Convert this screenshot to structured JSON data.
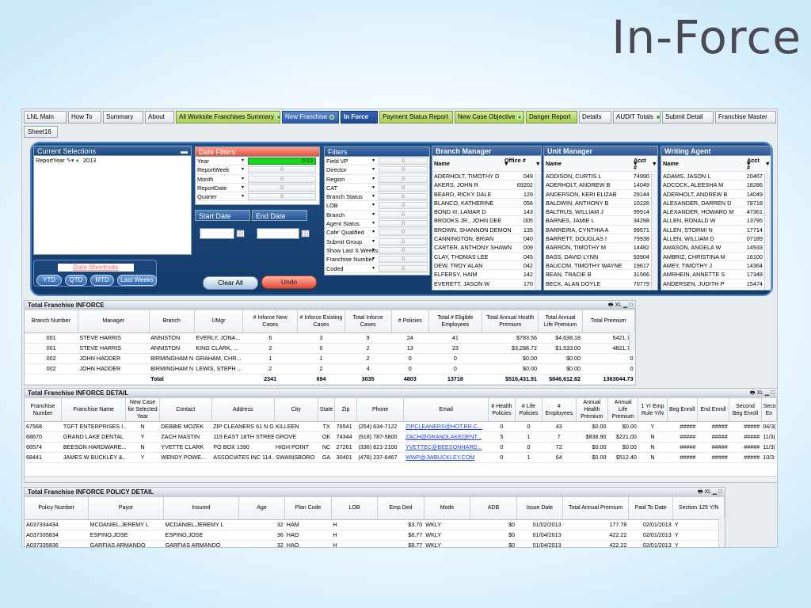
{
  "slide": {
    "title": "In-Force"
  },
  "tabs": [
    {
      "label": "LNL Main",
      "style": "plain"
    },
    {
      "label": "How To",
      "style": "plain"
    },
    {
      "label": "Summary",
      "style": "plain"
    },
    {
      "label": "About",
      "style": "plain"
    },
    {
      "label": "All Worksite Franchises Summary",
      "style": "green",
      "dot": true
    },
    {
      "label": "New Franchise",
      "style": "blue",
      "dot": true
    },
    {
      "label": "In Force",
      "style": "active"
    },
    {
      "label": "Payment Status Report",
      "style": "green",
      "dot": true
    },
    {
      "label": "New Case Objective",
      "style": "green",
      "dot": true
    },
    {
      "label": "Danger Report",
      "style": "green"
    },
    {
      "label": "Details",
      "style": "plain"
    },
    {
      "label": "AUDIT Totals",
      "style": "plain",
      "dot": true
    },
    {
      "label": "Submit Detail",
      "style": "plain"
    },
    {
      "label": "Franchise Master",
      "style": "plain"
    }
  ],
  "tab_row2": "Sheet16",
  "current_selections": {
    "title": "Current Selections",
    "field": "ReportYear",
    "value": "2013"
  },
  "date_filters": {
    "title": "Date Filters",
    "rows": [
      {
        "label": "Year",
        "value": "2013",
        "selected": true
      },
      {
        "label": "ReportWeek",
        "value": "0"
      },
      {
        "label": "Month",
        "value": "0"
      },
      {
        "label": "ReportDate",
        "value": "0"
      },
      {
        "label": "Quarter",
        "value": "0"
      }
    ],
    "start_label": "Start Date",
    "end_label": "End Date"
  },
  "shortcuts": {
    "title": "Date Shortcuts",
    "buttons": [
      "YTD",
      "QTD",
      "MTD",
      "Last Weeks"
    ]
  },
  "clear_label": "Clear All",
  "undo_label": "Undo",
  "filters": {
    "title": "Filters",
    "rows": [
      "Field VP",
      "Director",
      "Region",
      "CAT",
      "Branch Status",
      "LOB",
      "Branch",
      "Agent Status",
      "Cafe' Qualified",
      "Submit Group",
      "Show Last X Weeks",
      "Franchise Number",
      "Coded"
    ],
    "value": "0"
  },
  "branch_manager": {
    "title": "Branch Manager",
    "col1": "Name",
    "col2": "Office #",
    "rows": [
      [
        "ADERHOLT, TIMOTHY D",
        "049"
      ],
      [
        "AKERS, JOHN R",
        "69202"
      ],
      [
        "BEARD, RICKY DALE",
        "129"
      ],
      [
        "BLANCO, KATHERINE",
        "056"
      ],
      [
        "BOND III, LAMAR D",
        "143"
      ],
      [
        "BROOKS JR., JOHN DEE",
        "005"
      ],
      [
        "BROWN, SHANNON DEMON",
        "135"
      ],
      [
        "CANNINGTON, BRIAN",
        "040"
      ],
      [
        "CARTER, ANTHONY SHAWN",
        "009"
      ],
      [
        "CLAY, THOMAS LEE",
        "045"
      ],
      [
        "DEW, TROY ALAN",
        "042"
      ],
      [
        "ELFERSY, HAIM",
        "142"
      ],
      [
        "EVERETT, JASON W",
        "170"
      ]
    ]
  },
  "unit_manager": {
    "title": "Unit Manager",
    "col1": "Name",
    "col2": "Acct #",
    "rows": [
      [
        "ADDISON, CURTIS L",
        "74990"
      ],
      [
        "ADERHOLT, ANDREW B",
        "14049"
      ],
      [
        "ANDERSON, KERI ELIZAB",
        "29144"
      ],
      [
        "BALDWIN, ANTHONY B",
        "10226"
      ],
      [
        "BALTRUS, WILLIAM J",
        "99914"
      ],
      [
        "BARNES, JAMIE L",
        "34298"
      ],
      [
        "BARREIRA, CYNTHIA A",
        "99571"
      ],
      [
        "BARRETT, DOUGLAS I",
        "79938"
      ],
      [
        "BARRON, TIMOTHY M",
        "14482"
      ],
      [
        "BASS, DAVID LYNN",
        "93904"
      ],
      [
        "BAUCOM, TIMOTHY WAYNE",
        "19617"
      ],
      [
        "BEAN, TRACIE B",
        "31566"
      ],
      [
        "BECK, ALAN DOYLE",
        "70779"
      ]
    ]
  },
  "writing_agent": {
    "title": "Writing Agent",
    "col1": "Name",
    "col2": "Acct #",
    "rows": [
      [
        "ADAMS, JASON L",
        "20467"
      ],
      [
        "ADCOCK, ALEESHA M",
        "18286"
      ],
      [
        "ADERHOLT, ANDREW B",
        "14049"
      ],
      [
        "ALEXANDER, DARREN D",
        "78718"
      ],
      [
        "ALEXANDER, HOWARD M",
        "47361"
      ],
      [
        "ALLEN, RONALD W",
        "13795"
      ],
      [
        "ALLEN, STORMI N",
        "17714"
      ],
      [
        "ALLEN, WILLIAM D",
        "07189"
      ],
      [
        "AMASON, ANGELA W",
        "14933"
      ],
      [
        "AMBRIZ, CHRISTINA M",
        "16100"
      ],
      [
        "AMEY, TIMOTHY J",
        "14364"
      ],
      [
        "AMRHEIN, ANNETTE S",
        "17348"
      ],
      [
        "ANDERSEN, JUDITH P",
        "15474"
      ]
    ]
  },
  "inforce": {
    "title": "Total Franchise INFORCE",
    "controls": "🖶 XL ▁ ◻",
    "headers": [
      "Branch Number",
      "Manager",
      "Branch",
      "UMgr",
      "# Inforce New Cases",
      "# Inforce Existing Cases",
      "Total Inforce Cases",
      "# Policies",
      "Total # Eligible Employees",
      "Total Annual Health Premium",
      "Total Annual Life Premium",
      "Total Premium"
    ],
    "rows": [
      [
        "001",
        "STEVE HARRIS",
        "ANNISTON",
        "EVERLY, JONA...",
        "6",
        "3",
        "9",
        "24",
        "41",
        "$783.56",
        "$4,638.18",
        "5421.74"
      ],
      [
        "001",
        "STEVE HARRIS",
        "ANNISTON",
        "KING CLARK, ...",
        "2",
        "0",
        "2",
        "13",
        "23",
        "$3,288.72",
        "$1,533.00",
        "4821.72"
      ],
      [
        "002",
        "JOHN HADDER",
        "BIRMINGHAM N",
        "GRAHAM, CHR...",
        "1",
        "1",
        "2",
        "0",
        "0",
        "$0.00",
        "$0.00",
        "0"
      ],
      [
        "002",
        "JOHN HADDER",
        "BIRMINGHAM N",
        "LEWIS, STEPH ...",
        "2",
        "2",
        "4",
        "0",
        "0",
        "$0.00",
        "$0.00",
        "0"
      ]
    ],
    "total": [
      "",
      "",
      "Total",
      "",
      "2341",
      "694",
      "3035",
      "4803",
      "13718",
      "$516,431.91",
      "$846,612.82",
      "1363044.73"
    ]
  },
  "detail": {
    "title": "Total Franchise INFORCE DETAIL",
    "controls": "🖶 XL ▁ ◻",
    "headers": [
      "Franchise Number",
      "Franchise Name",
      "New Case for Selected Year",
      "Contact",
      "Address",
      "City",
      "State",
      "Zip",
      "Phone",
      "Email",
      "# Health Policies",
      "# Life Policies",
      "# Employees",
      "Annual Health Premium",
      "Annual Life Premium",
      "1 Yr Emp Rule Y/N",
      "Beg Enroll",
      "End Enroll",
      "Second Beg Enroll",
      "Second En"
    ],
    "rows": [
      [
        "67568",
        "TGFT ENTERPRISES I...",
        "N",
        "DEBBIE MOZEK",
        "ZIP CLEANERS 61 N GI...",
        "KILLEEN",
        "TX",
        "76541",
        "(254) 634-7122",
        "ZIPCLEANERS@HOT.RR.C...",
        "0",
        "0",
        "43",
        "$0.00",
        "$0.00",
        "Y",
        "#####",
        "#####",
        "#####",
        "04/3("
      ],
      [
        "68670",
        "GRAND LAKE DENTAL",
        "Y",
        "ZACH MASTIN",
        "119 EAST 18TH STREET",
        "GROVE",
        "OK",
        "74344",
        "(918) 787-5800",
        "ZACH@GRANDLAKEDENT...",
        "5",
        "1",
        "7",
        "$838.90",
        "$221.00",
        "N",
        "#####",
        "#####",
        "#####",
        "11/3("
      ],
      [
        "66574",
        "BEESON HARDWARE...",
        "N",
        "YVETTE CLARK",
        "PO BOX 1390",
        "HIGH POINT",
        "NC",
        "27261",
        "(336) 821-2100",
        "YVETTEC@BEESONHARD...",
        "0",
        "0",
        "72",
        "$0.00",
        "$0.00",
        "N",
        "#####",
        "#####",
        "#####",
        "11/3("
      ],
      [
        "68441",
        "JAMES W BUCKLEY &...",
        "Y",
        "WENDY POWE...",
        "ASSOCIATES INC 114...",
        "SWAINSBORO",
        "GA",
        "30401",
        "(478) 237-6467",
        "WWP@JWBUCKLEY.COM",
        "0",
        "1",
        "64",
        "$0.00",
        "$512.40",
        "N",
        "#####",
        "#####",
        "#####",
        "10/3:"
      ]
    ]
  },
  "policy": {
    "title": "Total Franchise INFORCE POLICY DETAIL",
    "controls": "🖶 XL ▁ ◻",
    "headers": [
      "Policy Number",
      "Payor",
      "Insured",
      "Age",
      "Plan Code",
      "LOB",
      "Emp Ded",
      "Mode",
      "ADB",
      "Issue Date",
      "Total Annual Premium",
      "Paid To Date",
      "Section 125 Y/N"
    ],
    "rows": [
      [
        "A037334434",
        "MCDANIEL,JEREMY L",
        "MCDANIEL,JEREMY L",
        "32",
        "HAM",
        "H",
        "$3.70",
        "WKLY",
        "$0",
        "01/02/2013",
        "177.78",
        "02/01/2013",
        "Y"
      ],
      [
        "A037335834",
        "ESPINO,JOSE",
        "ESPINO,JOSE",
        "36",
        "HAO",
        "H",
        "$8.77",
        "WKLY",
        "$0",
        "01/04/2013",
        "422.22",
        "02/01/2013",
        "Y"
      ],
      [
        "A037335836",
        "GARFIAS ARMANDO",
        "GARFIAS ARMANDO",
        "32",
        "HAO",
        "H",
        "$8.77",
        "WKLY",
        "$0",
        "01/04/2013",
        "422.22",
        "02/01/2013",
        "Y"
      ]
    ]
  }
}
